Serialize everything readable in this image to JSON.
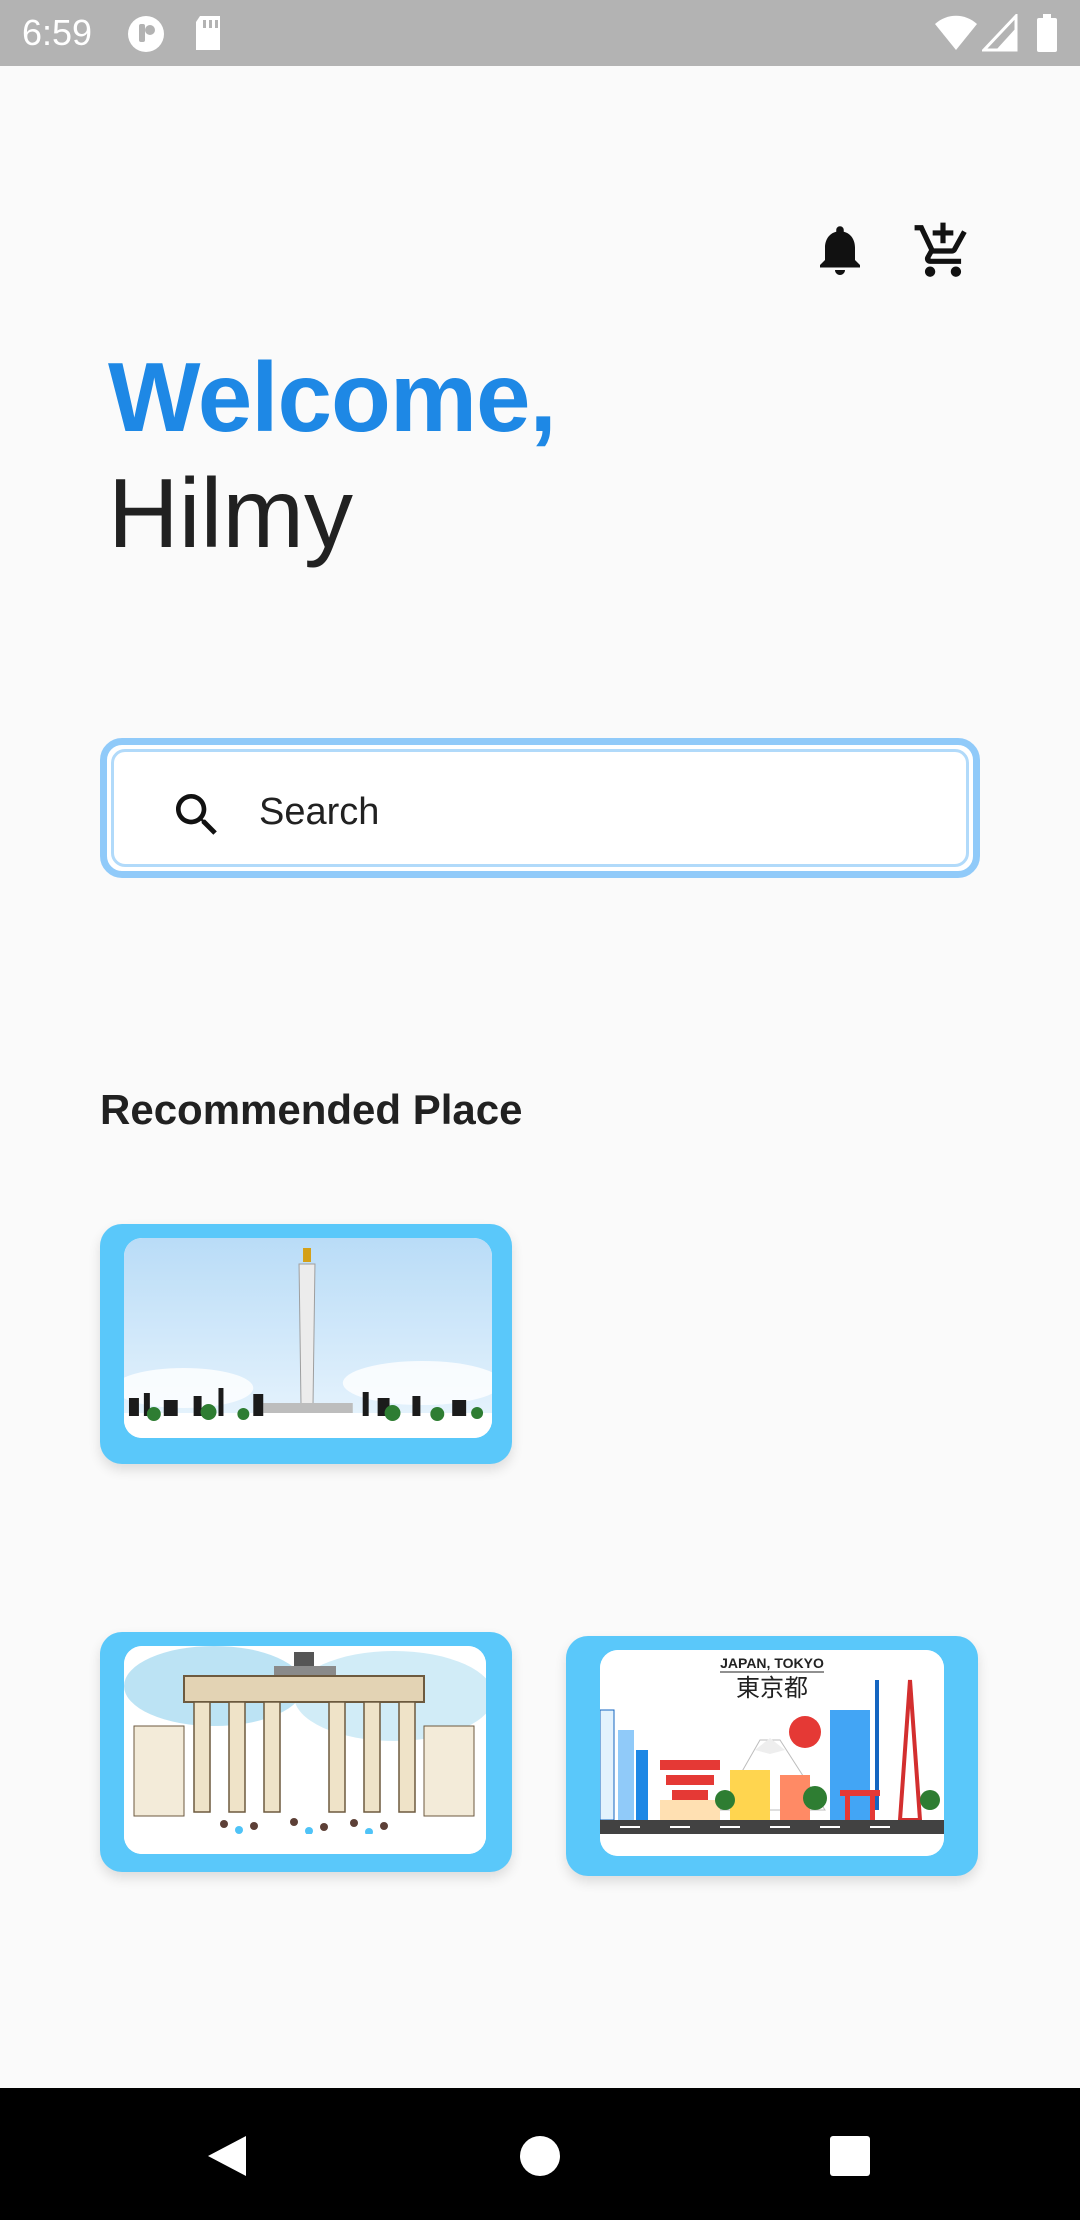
{
  "status_bar": {
    "time": "6:59",
    "left_icons": [
      "notification-app-icon",
      "sd-card-icon"
    ],
    "right_icons": [
      "wifi-icon",
      "cellular-signal-icon",
      "battery-icon"
    ]
  },
  "header": {
    "icons": [
      "bell-icon",
      "add-to-cart-icon"
    ]
  },
  "greeting": {
    "welcome": "Welcome,",
    "name": "Hilmy"
  },
  "search": {
    "placeholder": "Search",
    "value": "",
    "icon": "search-icon"
  },
  "recommended": {
    "title": "Recommended Place",
    "places": [
      {
        "name": "monas-jakarta",
        "caption": ""
      },
      {
        "name": "brandenburg-gate",
        "caption": ""
      },
      {
        "name": "japan-tokyo",
        "caption": "JAPAN, TOKYO",
        "kanji": "東京都"
      }
    ]
  },
  "nav_bar": {
    "buttons": [
      "back-icon",
      "home-icon",
      "recents-icon"
    ]
  },
  "colors": {
    "accent": "#1e88e5",
    "card_bg": "#5ac8fa",
    "search_border": "#90caf9",
    "status_bar": "#b3b3b3",
    "background": "#fafafa"
  }
}
